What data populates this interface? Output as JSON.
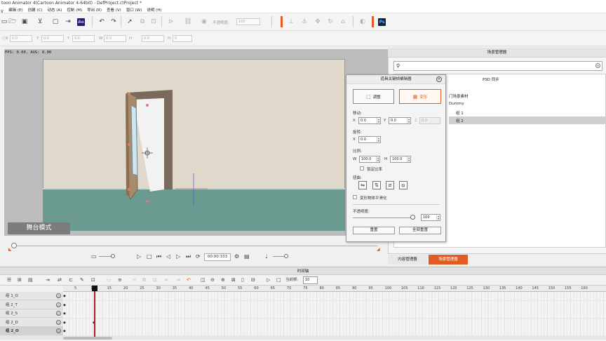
{
  "window": {
    "title": "toon Animator 4(Cartoon Animator 4-64bit) - DefProject.ctProject *"
  },
  "menu": [
    "ᠳ",
    "编辑 (E)",
    "创建 (C)",
    "动态 (A)",
    "控制 (M)",
    "导出 (R)",
    "查看 (V)",
    "窗口 (W)",
    "说明 (H)"
  ],
  "toolbar1": {
    "opacity_label": "不透明度:",
    "opacity_value": "100",
    "ae_label": "Ae",
    "ps_label": "Ps"
  },
  "toolbar2": {
    "fields": [
      {
        "label": "X",
        "value": "0.0"
      },
      {
        "label": "Y",
        "value": "0.0"
      },
      {
        "label": "Y",
        "value": "0.0"
      },
      {
        "label": "W",
        "value": "0.0"
      },
      {
        "label": "H",
        "value": "0.0"
      },
      {
        "label": "H",
        "value": "0"
      }
    ]
  },
  "stage": {
    "fps_text": "FPS: 0.00, AVG: 0.00",
    "mode_label": "舞台模式",
    "current_frame": "00:00:333"
  },
  "dialog": {
    "title": "道具关键帧编辑器",
    "mode_adjust": "调整",
    "mode_transform": "变形",
    "move_label": "移动:",
    "move_x_label": "X",
    "move_x": "0.0",
    "move_y_label": "Y",
    "move_y": "0.0",
    "move_z_label": "Z",
    "move_z": "0.0",
    "rotate_label": "旋转:",
    "rotate_x_label": "X",
    "rotate_x": "0.0",
    "scale_label": "比例:",
    "scale_w_label": "W",
    "scale_w": "100.0",
    "scale_h_label": "H",
    "scale_h": "100.0",
    "lock_ratio": "锁定比率",
    "flip_label": "扭曲:",
    "smooth_label": "变形物体平滑化",
    "opacity_label": "不透明度:",
    "opacity_value": "100",
    "opacity_fraction": 1.0,
    "reset_button": "重置",
    "reset_all_button": "全部重置"
  },
  "scene_manager": {
    "title": "场景管理器",
    "psd_sync": "PSD 同步",
    "tree": [
      "门场景素材",
      "Dummy",
      "组 1",
      "组 2"
    ],
    "tab_content": "内容管理器",
    "tab_scene": "场景管理器"
  },
  "timeline": {
    "title": "时间轴",
    "current_frame_label": "当前帧:",
    "current_frame_value": "10",
    "ruler": [
      "5",
      "10",
      "15",
      "20",
      "25",
      "30",
      "35",
      "40",
      "45",
      "50",
      "55",
      "60",
      "65",
      "70",
      "75",
      "80",
      "85",
      "90",
      "95",
      "100",
      "105",
      "110",
      "115",
      "120",
      "125",
      "130",
      "135",
      "140",
      "145",
      "150",
      "155",
      "160"
    ],
    "tracks": [
      {
        "name": "组 1_O"
      },
      {
        "name": "组 2_T"
      },
      {
        "name": "组 2_S"
      },
      {
        "name": "组 2_D"
      },
      {
        "name": "组 2_O"
      }
    ]
  },
  "colors": {
    "accent": "#e25b22",
    "floor": "#6a9a90",
    "wall": "#e1d9cb"
  }
}
